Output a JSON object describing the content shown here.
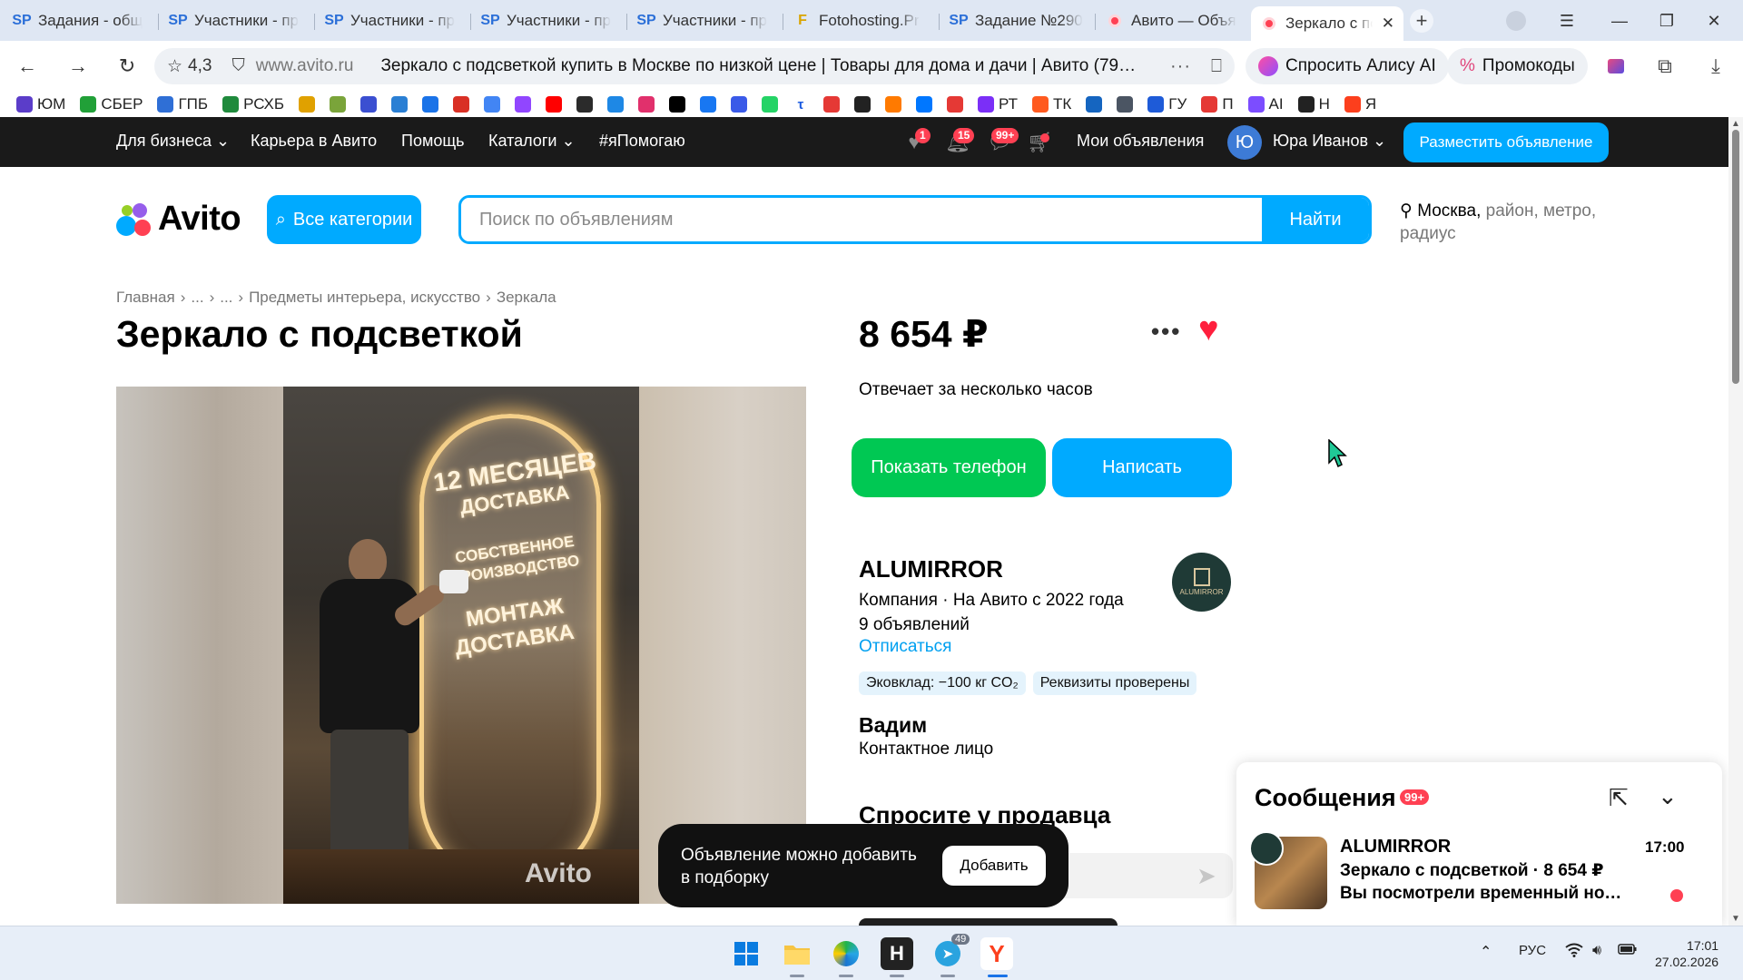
{
  "browser": {
    "tabs": [
      {
        "label": "Задания - общ",
        "icon": "SP"
      },
      {
        "label": "Участники - пр",
        "icon": "SP"
      },
      {
        "label": "Участники - пр",
        "icon": "SP"
      },
      {
        "label": "Участники - пр",
        "icon": "SP"
      },
      {
        "label": "Участники - пр",
        "icon": "SP"
      },
      {
        "label": "Fotohosting.Pr",
        "icon": "F"
      },
      {
        "label": "Задание №290",
        "icon": "SP"
      },
      {
        "label": "Авито — Объя",
        "icon": "avito"
      },
      {
        "label": "Зеркало с по",
        "icon": "avito"
      }
    ],
    "address": {
      "rating": "4,3",
      "domain": "www.avito.ru",
      "page_title": "Зеркало с подсветкой купить в Москве по низкой цене | Товары для дома и дачи | Авито (79…"
    },
    "alice_button": "Спросить Алису AI",
    "promo_button": "Промокоды",
    "bookmarks": [
      {
        "label": "ЮМ",
        "color": "#5b3dc9"
      },
      {
        "label": "СБЕР",
        "color": "#21a038"
      },
      {
        "label": "ГПБ",
        "color": "#2f6fd6"
      },
      {
        "label": "РСХБ",
        "color": "#1f8a3c"
      },
      {
        "label": "",
        "color": "#e0a100"
      },
      {
        "label": "",
        "color": "#7aa43a"
      },
      {
        "label": "",
        "color": "#3b4fd1"
      },
      {
        "label": "",
        "color": "#2a7fd4"
      },
      {
        "label": "",
        "color": "#1a73e8"
      },
      {
        "label": "",
        "color": "#d93025"
      },
      {
        "label": "",
        "color": "#4285f4"
      },
      {
        "label": "",
        "color": "#9146ff"
      },
      {
        "label": "",
        "color": "#ff0000"
      },
      {
        "label": "",
        "color": "#2b2b2b"
      },
      {
        "label": "",
        "color": "#1e88e5"
      },
      {
        "label": "",
        "color": "#e1306c"
      },
      {
        "label": "",
        "color": "#000000"
      },
      {
        "label": "",
        "color": "#1877f2"
      },
      {
        "label": "",
        "color": "#3a5ae8"
      },
      {
        "label": "",
        "color": "#25d366"
      },
      {
        "label": "τ",
        "color": "#ffffff"
      },
      {
        "label": "",
        "color": "#e53935"
      },
      {
        "label": "",
        "color": "#222222"
      },
      {
        "label": "",
        "color": "#ff7a00"
      },
      {
        "label": "",
        "color": "#0077ff"
      },
      {
        "label": "",
        "color": "#e53935"
      },
      {
        "label": "РТ",
        "color": "#7b2ff7"
      },
      {
        "label": "ТК",
        "color": "#ff5a1f"
      },
      {
        "label": "",
        "color": "#1565c0"
      },
      {
        "label": "",
        "color": "#4b5563"
      },
      {
        "label": "ГУ",
        "color": "#1e5bd8"
      },
      {
        "label": "П",
        "color": "#e53935"
      },
      {
        "label": "AI",
        "color": "#7c4dff"
      },
      {
        "label": "Н",
        "color": "#222222"
      },
      {
        "label": "Я",
        "color": "#fc3f1d"
      }
    ]
  },
  "avito_nav": {
    "links": [
      "Для бизнеса",
      "Карьера в Авито",
      "Помощь",
      "Каталоги",
      "#яПомогаю"
    ],
    "favorites_badge": "1",
    "notifications_badge": "15",
    "messages_badge": "99+",
    "my_ads": "Мои объявления",
    "user_initial": "Ю",
    "user_name": "Юра Иванов",
    "post_button": "Разместить объявление"
  },
  "header": {
    "logo": "Avito",
    "categories_button": "Все категории",
    "search_placeholder": "Поиск по объявлениям",
    "search_button": "Найти",
    "location_city": "Москва,",
    "location_rest": "район, метро, радиус"
  },
  "breadcrumb": [
    "Главная",
    "...",
    "...",
    "Предметы интерьера, искусство",
    "Зеркала"
  ],
  "listing": {
    "title": "Зеркало с подсветкой",
    "price": "8 654 ₽",
    "reply_time": "Отвечает за несколько часов",
    "show_phone": "Показать телефон",
    "write": "Написать",
    "image_text": [
      "12 МЕСЯЦЕВ",
      "ДОСТАВКА",
      "СОБСТВЕННОЕ",
      "ПРОИЗВОДСТВО",
      "МОНТАЖ",
      "ДОСТАВКА"
    ],
    "watermark": "Avito"
  },
  "seller": {
    "name": "ALUMIRROR",
    "type": "Компания · На Авито с 2022 года",
    "ads_count": "9 объявлений",
    "unsubscribe": "Отписаться",
    "tags": [
      "Эковклад: −100 кг CO₂",
      "Реквизиты проверены"
    ],
    "logo_text": "ALUMIRROR",
    "contact_name": "Вадим",
    "contact_role": "Контактное лицо",
    "ask_title": "Спросите у продавца"
  },
  "toast": {
    "text": "Объявление можно добавить в подборку",
    "button": "Добавить"
  },
  "messages": {
    "title": "Сообщения",
    "badge": "99+",
    "sender": "ALUMIRROR",
    "time": "17:00",
    "subject": "Зеркало с подсветкой · 8 654 ₽",
    "preview": "Вы посмотрели временный ном…"
  },
  "taskbar": {
    "telegram_badge": "49",
    "lang": "РУС",
    "time": "17:01",
    "date": "27.02.2026"
  },
  "colors": {
    "avito_blue": "#00aaff",
    "avito_green": "#00c853",
    "avito_red": "#ff4053",
    "dark_bar": "#1a1a1a"
  }
}
